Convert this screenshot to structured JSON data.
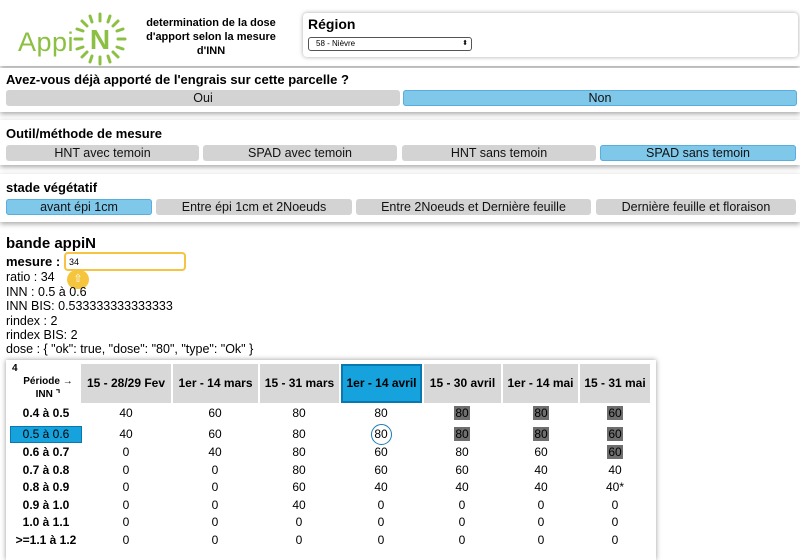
{
  "header": {
    "logo_text": "Appi",
    "logo_letter": "N",
    "doc_title": "determination de la dose d'apport selon la mesure d'INN",
    "region_label": "Région",
    "region_value": "58 - Nièvre",
    "region_arrows": "⬍"
  },
  "q_engrais": {
    "title": "Avez-vous déjà apporté de l'engrais sur cette parcelle ?",
    "options": [
      "Oui",
      "Non"
    ],
    "selected": "Non"
  },
  "outil": {
    "title": "Outil/méthode de mesure",
    "options": [
      "HNT avec temoin",
      "SPAD avec temoin",
      "HNT sans temoin",
      "SPAD sans temoin"
    ],
    "selected": "SPAD sans temoin"
  },
  "stade": {
    "title": "stade végétatif",
    "options": [
      "avant épi 1cm",
      "Entre épi 1cm et 2Noeuds",
      "Entre 2Noeuds et Dernière feuille",
      "Dernière feuille et floraison"
    ],
    "selected": "avant épi 1cm"
  },
  "bande": {
    "title": "bande appiN",
    "mesure_label": "mesure :",
    "mesure_value": "34",
    "keyboard_icon": "⇧",
    "info_lines": [
      "ratio : 34",
      "INN : 0.5 à 0.6",
      "INN BIS: 0.533333333333333",
      "rindex : 2",
      "rindex BIS: 2",
      "dose : { \"ok\": true, \"dose\": \"80\", \"type\": \"Ok\" }"
    ]
  },
  "table": {
    "corner_number": "4",
    "corner_line1": "Période →",
    "corner_line2": "INN ⌝",
    "columns": [
      "15 - 28/29 Fev",
      "1er - 14 mars",
      "15 - 31 mars",
      "1er - 14 avril",
      "15 - 30 avril",
      "1er - 14 mai",
      "15 - 31 mai"
    ],
    "selected_column": 3,
    "selected_row": 1,
    "rows": [
      {
        "label": "0.4 à 0.5",
        "cells": [
          "40",
          "60",
          "80",
          "80",
          "80",
          "80",
          "60"
        ]
      },
      {
        "label": "0.5 à 0.6",
        "cells": [
          "40",
          "60",
          "80",
          "80",
          "80",
          "80",
          "60"
        ]
      },
      {
        "label": "0.6 à 0.7",
        "cells": [
          "0",
          "40",
          "80",
          "60",
          "80",
          "60",
          "60"
        ]
      },
      {
        "label": "0.7 à 0.8",
        "cells": [
          "0",
          "0",
          "80",
          "60",
          "60",
          "40",
          "40"
        ]
      },
      {
        "label": "0.8 à 0.9",
        "cells": [
          "0",
          "0",
          "60",
          "40",
          "40",
          "40",
          "40*"
        ]
      },
      {
        "label": "0.9 à 1.0",
        "cells": [
          "0",
          "0",
          "40",
          "0",
          "0",
          "0",
          "0"
        ]
      },
      {
        "label": "1.0 à 1.1",
        "cells": [
          "0",
          "0",
          "0",
          "0",
          "0",
          "0",
          "0"
        ]
      },
      {
        "label": ">=1.1 à 1.2",
        "cells": [
          "0",
          "0",
          "0",
          "0",
          "0",
          "0",
          "0"
        ]
      }
    ],
    "grey_cells": [
      [
        0,
        4
      ],
      [
        0,
        5
      ],
      [
        0,
        6
      ],
      [
        1,
        4
      ],
      [
        1,
        5
      ],
      [
        1,
        6
      ],
      [
        2,
        6
      ]
    ],
    "circled_cell": [
      1,
      3
    ]
  },
  "colors": {
    "brand_green": "#8cc043",
    "selected_button": "#80c8ea",
    "selected_cell": "#16a2dc",
    "default_button": "#d3d3d3",
    "highlight_input": "#f6c343"
  }
}
